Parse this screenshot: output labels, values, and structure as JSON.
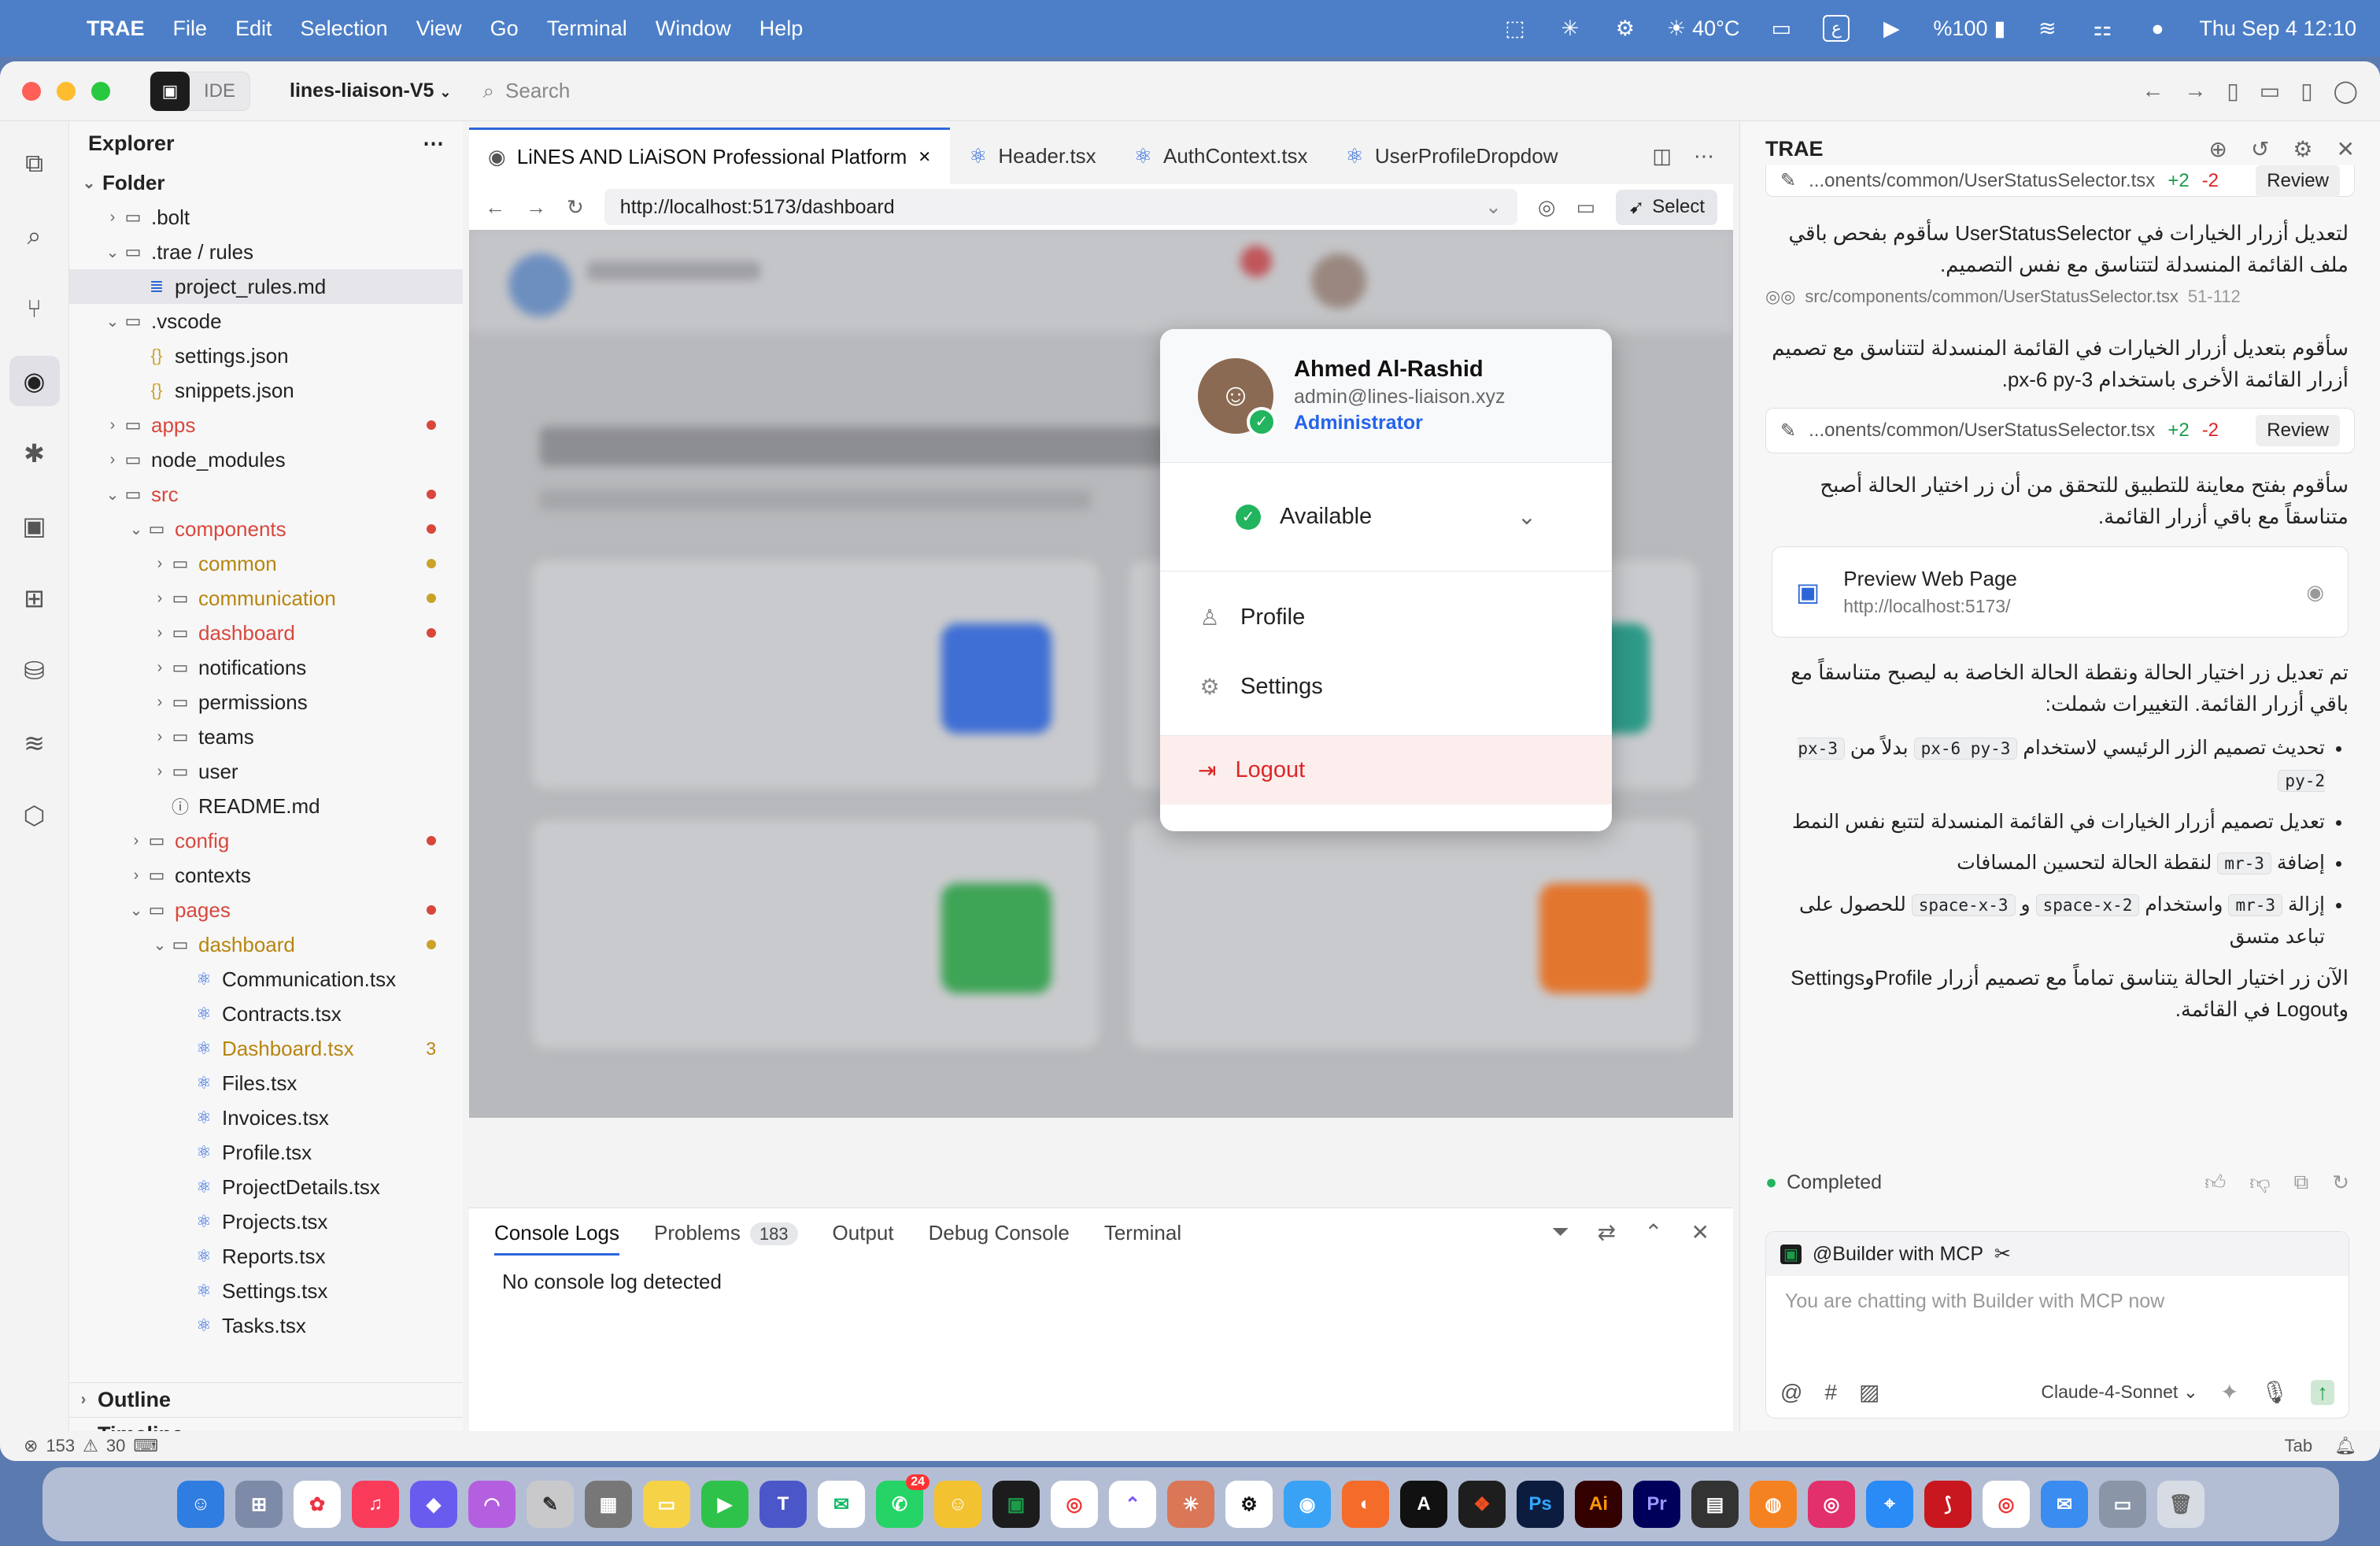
{
  "menubar": {
    "app": "TRAE",
    "items": [
      "File",
      "Edit",
      "Selection",
      "View",
      "Go",
      "Terminal",
      "Window",
      "Help"
    ],
    "weather": "40°C",
    "lang": "ع",
    "battery": "%100",
    "datetime": "Thu Sep 4  12:10"
  },
  "titlebar": {
    "ide_label": "IDE",
    "project": "lines-liaison-V5",
    "search_placeholder": "Search"
  },
  "explorer": {
    "title": "Explorer",
    "root": "Folder",
    "rows": [
      {
        "label": ".bolt",
        "d": 0,
        "type": "folder",
        "open": false
      },
      {
        "label": ".trae / rules",
        "d": 0,
        "type": "folder",
        "open": true
      },
      {
        "label": "project_rules.md",
        "d": 1,
        "type": "md",
        "sel": true
      },
      {
        "label": ".vscode",
        "d": 0,
        "type": "folder",
        "open": true
      },
      {
        "label": "settings.json",
        "d": 1,
        "type": "json"
      },
      {
        "label": "snippets.json",
        "d": 1,
        "type": "json"
      },
      {
        "label": "apps",
        "d": 0,
        "type": "folder",
        "open": false,
        "color": "#d9473c",
        "mod": "#d9473c"
      },
      {
        "label": "node_modules",
        "d": 0,
        "type": "folder",
        "open": false
      },
      {
        "label": "src",
        "d": 0,
        "type": "folder",
        "open": true,
        "color": "#d9473c",
        "mod": "#d9473c"
      },
      {
        "label": "components",
        "d": 1,
        "type": "folder",
        "open": true,
        "color": "#d9473c",
        "mod": "#d9473c"
      },
      {
        "label": "common",
        "d": 2,
        "type": "folder",
        "open": false,
        "color": "#b7850f",
        "mod": "#c9a227"
      },
      {
        "label": "communication",
        "d": 2,
        "type": "folder",
        "open": false,
        "color": "#b7850f",
        "mod": "#c9a227"
      },
      {
        "label": "dashboard",
        "d": 2,
        "type": "folder",
        "open": false,
        "color": "#d9473c",
        "mod": "#d9473c"
      },
      {
        "label": "notifications",
        "d": 2,
        "type": "folder",
        "open": false
      },
      {
        "label": "permissions",
        "d": 2,
        "type": "folder",
        "open": false
      },
      {
        "label": "teams",
        "d": 2,
        "type": "folder",
        "open": false
      },
      {
        "label": "user",
        "d": 2,
        "type": "folder",
        "open": false
      },
      {
        "label": "README.md",
        "d": 2,
        "type": "info"
      },
      {
        "label": "config",
        "d": 1,
        "type": "folder",
        "open": false,
        "color": "#d9473c",
        "mod": "#d9473c"
      },
      {
        "label": "contexts",
        "d": 1,
        "type": "folder",
        "open": false
      },
      {
        "label": "pages",
        "d": 1,
        "type": "folder",
        "open": true,
        "color": "#d9473c",
        "mod": "#d9473c"
      },
      {
        "label": "dashboard",
        "d": 2,
        "type": "folder",
        "open": true,
        "color": "#b7850f",
        "mod": "#c9a227"
      },
      {
        "label": "Communication.tsx",
        "d": 3,
        "type": "tsx"
      },
      {
        "label": "Contracts.tsx",
        "d": 3,
        "type": "tsx"
      },
      {
        "label": "Dashboard.tsx",
        "d": 3,
        "type": "tsx",
        "color": "#b7850f",
        "count": "3"
      },
      {
        "label": "Files.tsx",
        "d": 3,
        "type": "tsx"
      },
      {
        "label": "Invoices.tsx",
        "d": 3,
        "type": "tsx"
      },
      {
        "label": "Profile.tsx",
        "d": 3,
        "type": "tsx"
      },
      {
        "label": "ProjectDetails.tsx",
        "d": 3,
        "type": "tsx"
      },
      {
        "label": "Projects.tsx",
        "d": 3,
        "type": "tsx"
      },
      {
        "label": "Reports.tsx",
        "d": 3,
        "type": "tsx"
      },
      {
        "label": "Settings.tsx",
        "d": 3,
        "type": "tsx"
      },
      {
        "label": "Tasks.tsx",
        "d": 3,
        "type": "tsx"
      }
    ],
    "outline": "Outline",
    "timeline": "Timeline"
  },
  "tabs": [
    {
      "label": "LiNES AND LiAiSON Professional Platform",
      "active": true
    },
    {
      "label": "Header.tsx"
    },
    {
      "label": "AuthContext.tsx"
    },
    {
      "label": "UserProfileDropdow"
    }
  ],
  "browser": {
    "url": "http://localhost:5173/dashboard",
    "select_label": "Select"
  },
  "dropdown": {
    "name": "Ahmed Al-Rashid",
    "email": "admin@lines-liaison.xyz",
    "role": "Administrator",
    "status": "Available",
    "profile": "Profile",
    "settings": "Settings",
    "logout": "Logout"
  },
  "panel": {
    "tabs": [
      "Console Logs",
      "Problems",
      "Output",
      "Debug Console",
      "Terminal"
    ],
    "problems_count": "183",
    "message": "No console log detected"
  },
  "trae": {
    "title": "TRAE",
    "chip1_file": "...onents/common/UserStatusSelector.tsx",
    "plus": "+2",
    "minus": "-2",
    "review": "Review",
    "p1": "لتعديل أزرار الخيارات في UserStatusSelector سأقوم بفحص باقي ملف القائمة المنسدلة لتتناسق مع نفس التصميم.",
    "ref_file": "src/components/common/UserStatusSelector.tsx",
    "ref_lines": "51-112",
    "p2": "سأقوم بتعديل أزرار الخيارات في القائمة المنسدلة لتتناسق مع تصميم أزرار القائمة الأخرى باستخدام px-6 py-3.",
    "p3": "سأقوم بفتح معاينة للتطبيق للتحقق من أن زر اختيار الحالة أصبح متناسقاً مع باقي أزرار القائمة.",
    "preview_title": "Preview Web Page",
    "preview_url": "http://localhost:5173/",
    "p4": "تم تعديل زر اختيار الحالة ونقطة الحالة الخاصة به ليصبح متناسقاً مع باقي أزرار القائمة. التغييرات شملت:",
    "b1_pre": "تحديث تصميم الزر الرئيسي لاستخدام",
    "b1_code1": "px-6 py-3",
    "b1_mid": "بدلاً من",
    "b1_code2": "px-3 py-2",
    "b2": "تعديل تصميم أزرار الخيارات في القائمة المنسدلة لتتبع نفس النمط",
    "b3_pre": "إضافة",
    "b3_code": "mr-3",
    "b3_post": "لنقطة الحالة لتحسين المسافات",
    "b4_pre": "إزالة",
    "b4_code1": "mr-3",
    "b4_mid": "واستخدام",
    "b4_code2": "space-x-2",
    "b4_and": "و",
    "b4_code3": "space-x-3",
    "b4_post": "للحصول على تباعد متسق",
    "p5": "الآن زر اختيار الحالة يتناسق تماماً مع تصميم أزرار ProfileوSettings وLogout في القائمة.",
    "completed": "Completed",
    "builder": "@Builder with MCP",
    "chat_placeholder": "You are chatting with Builder with MCP now",
    "model": "Claude-4-Sonnet"
  },
  "statusbar": {
    "errors": "153",
    "warnings": "30",
    "tab": "Tab"
  },
  "dock": {
    "badge": "24"
  }
}
